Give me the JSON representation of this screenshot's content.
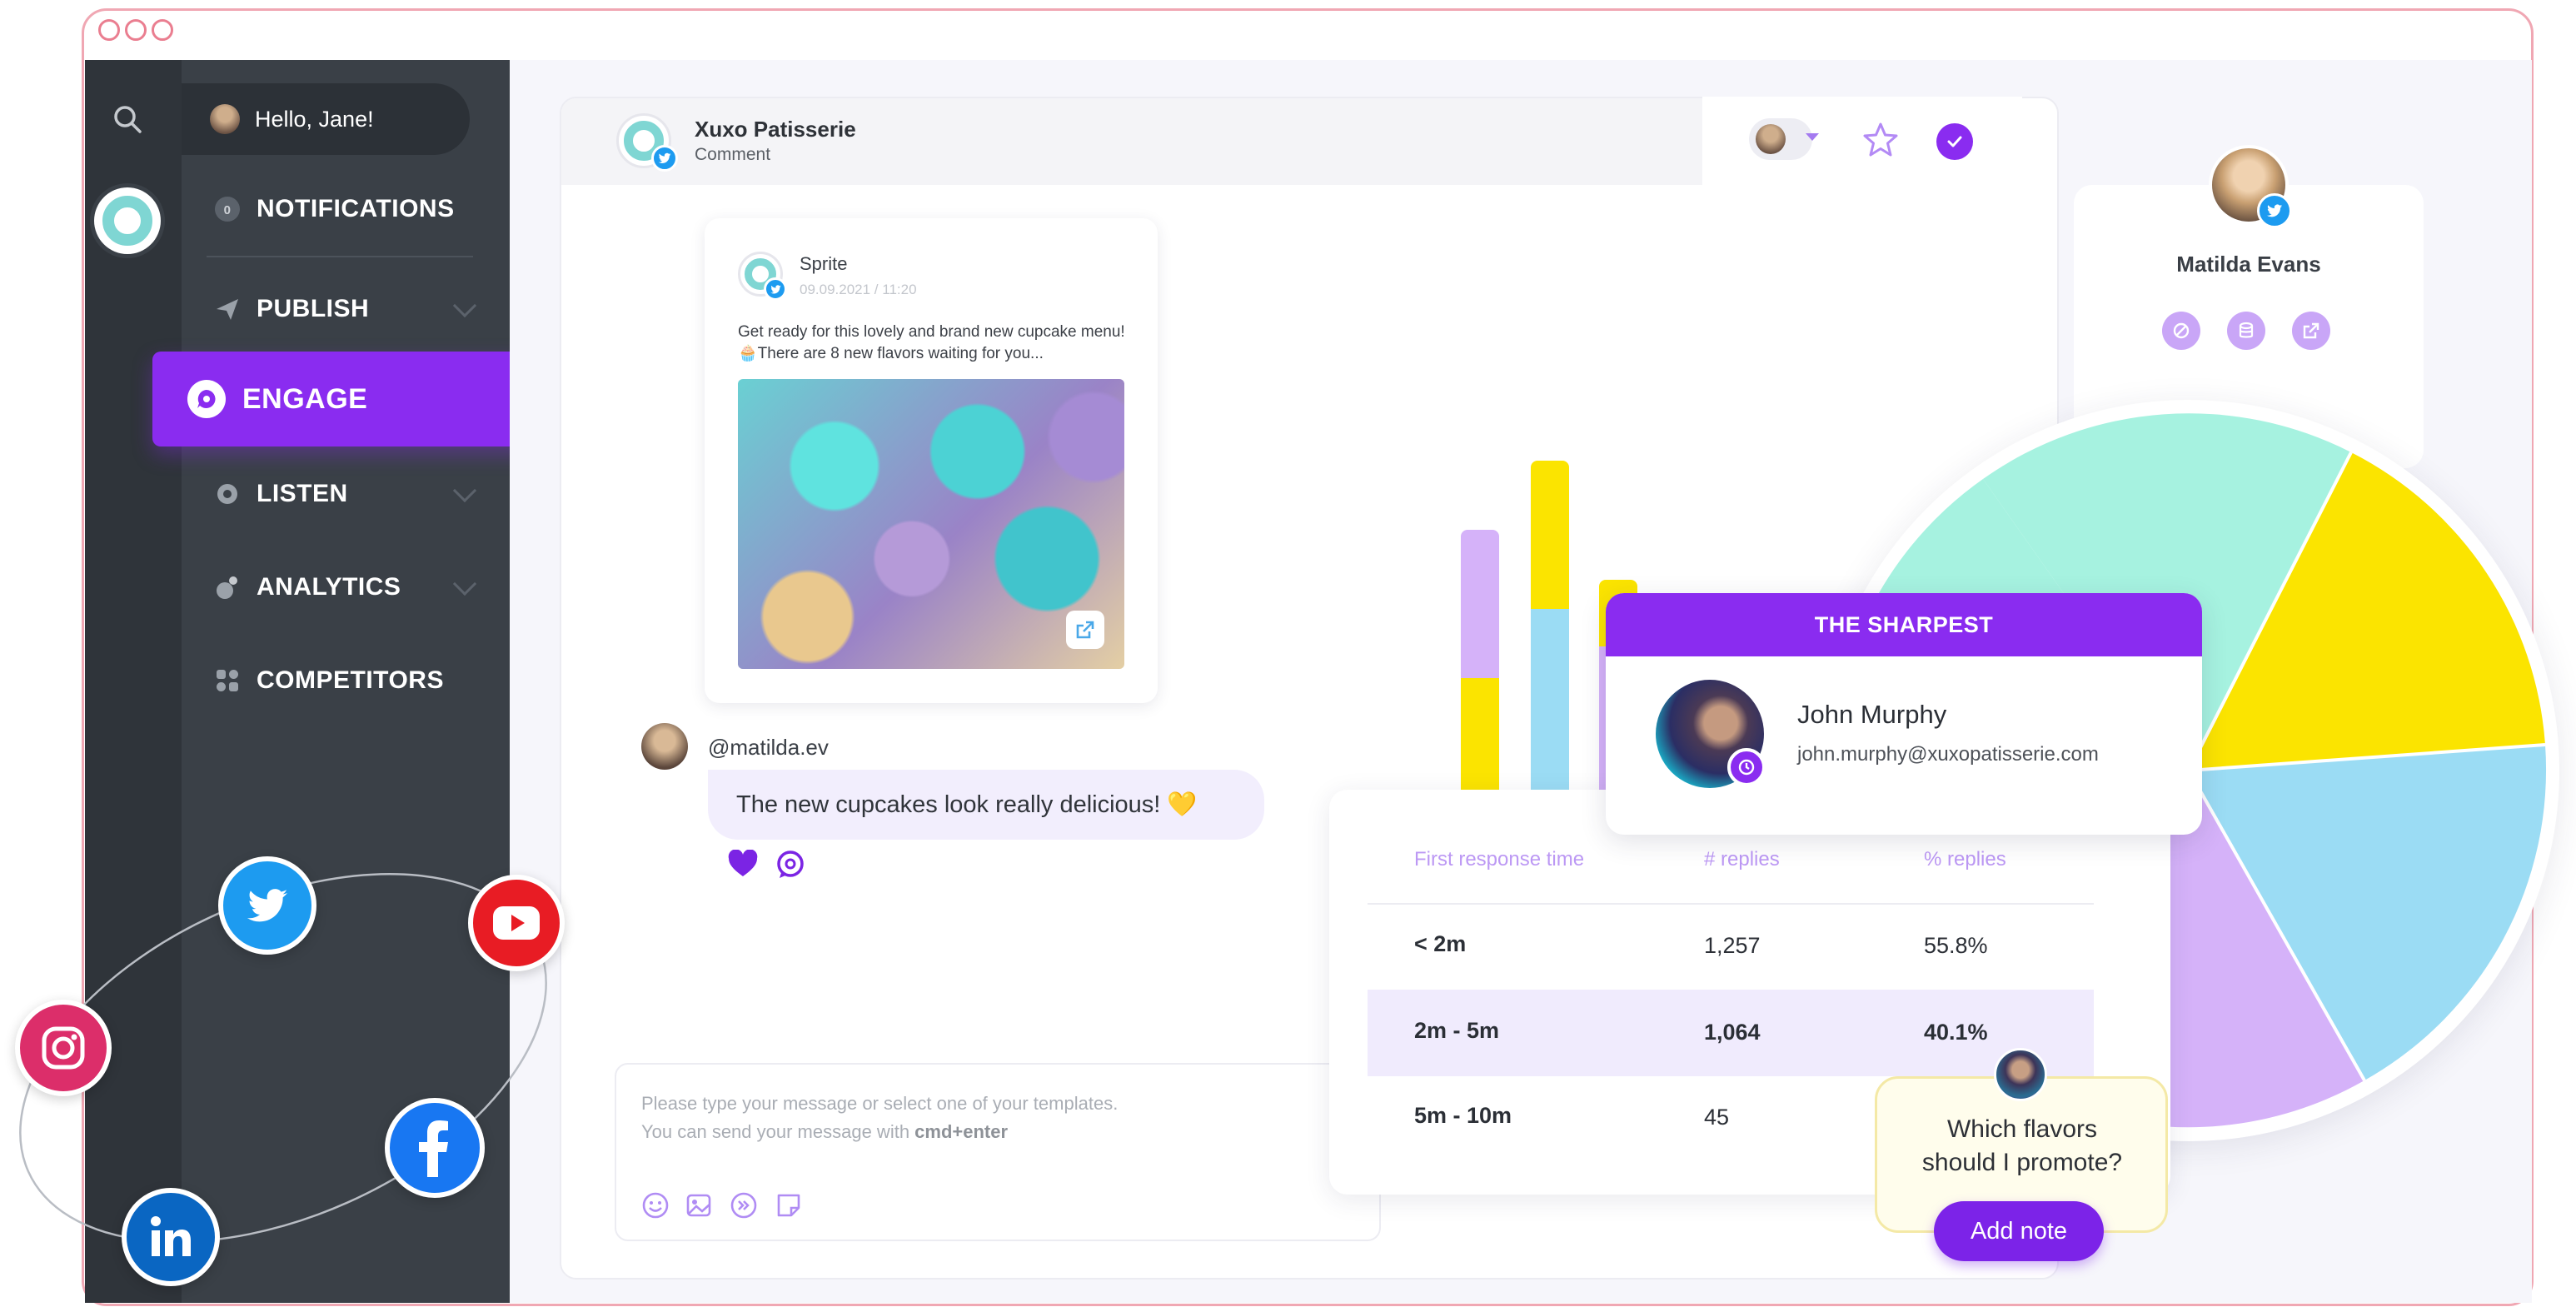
{
  "window": {
    "controls": [
      "close",
      "minimize",
      "maximize"
    ]
  },
  "sidebar": {
    "greeting": "Hello, Jane!",
    "items": [
      {
        "label": "NOTIFICATIONS",
        "badge": "0",
        "icon": "bell-icon"
      },
      {
        "label": "PUBLISH",
        "icon": "paper-plane-icon"
      },
      {
        "label": "ENGAGE",
        "icon": "chat-bubble-icon",
        "active": true
      },
      {
        "label": "LISTEN",
        "icon": "ear-icon"
      },
      {
        "label": "ANALYTICS",
        "icon": "chart-icon"
      },
      {
        "label": "COMPETITORS",
        "icon": "grid-icon"
      }
    ]
  },
  "conversation": {
    "account_name": "Xuxo Patisserie",
    "type": "Comment",
    "post": {
      "author": "Sprite",
      "date": "09.09.2021 / 11:20",
      "text": "Get ready for this lovely and brand new cupcake menu! 🧁There are 8 new flavors waiting for you..."
    },
    "comment": {
      "handle": "@matilda.ev",
      "text": "The new cupcakes look really delicious! 💛"
    },
    "composer": {
      "placeholder_line1": "Please type your message or select one of your templates.",
      "placeholder_line2_prefix": "You can send your message with ",
      "placeholder_line2_key": "cmd+enter"
    }
  },
  "profile": {
    "name": "Matilda Evans"
  },
  "response_table": {
    "headers": [
      "First response time",
      "# replies",
      "% replies"
    ],
    "rows": [
      [
        "< 2m",
        "1,257",
        "55.8%"
      ],
      [
        "2m - 5m",
        "1,064",
        "40.1%"
      ],
      [
        "5m - 10m",
        "45",
        ""
      ]
    ],
    "highlighted_row": 1
  },
  "sharpest": {
    "title": "THE SHARPEST",
    "name": "John Murphy",
    "email": "john.murphy@xuxopatisserie.com"
  },
  "note": {
    "text_line1": "Which flavors",
    "text_line2": "should I promote?",
    "button": "Add note"
  },
  "colors": {
    "accent": "#8a2cf0",
    "sidebar": "#3a4047",
    "rail": "#2f343a",
    "mint": "#a6f2e0",
    "yellow": "#fbe400",
    "sky": "#9bdcf4",
    "lavender": "#d5b2f9"
  },
  "social_networks": [
    "twitter",
    "youtube",
    "instagram",
    "facebook",
    "linkedin"
  ]
}
